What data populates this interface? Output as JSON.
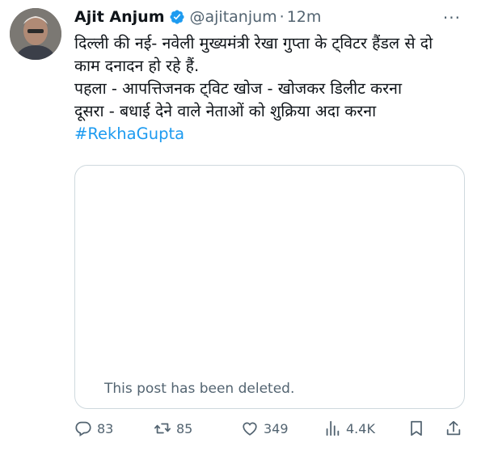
{
  "tweet": {
    "author_name": "Ajit Anjum",
    "handle": "@ajitanjum",
    "separator": "·",
    "time": "12m",
    "more": "···",
    "lines": [
      "दिल्ली की नई- नवेली मुख्यमंत्री रेखा गुप्ता के ट्विटर हैंडल से दो",
      "काम दनादन हो रहे हैं.",
      "पहला - आपत्तिजनक ट्विट खोज - खोजकर डिलीट करना",
      "दूसरा - बधाई देने वाले नेताओं को शुक्रिया अदा करना"
    ],
    "hashtag": "#RekhaGupta",
    "quoted_status": "This post has been deleted."
  },
  "actions": {
    "replies": "83",
    "reposts": "85",
    "likes": "349",
    "views": "4.4K"
  },
  "colors": {
    "accent": "#1d9bf0",
    "secondary_text": "#536471",
    "border": "#cfd9de"
  },
  "icons": [
    "verified-badge-icon",
    "more-icon",
    "reply-icon",
    "repost-icon",
    "like-icon",
    "views-icon",
    "bookmark-icon",
    "share-icon"
  ]
}
